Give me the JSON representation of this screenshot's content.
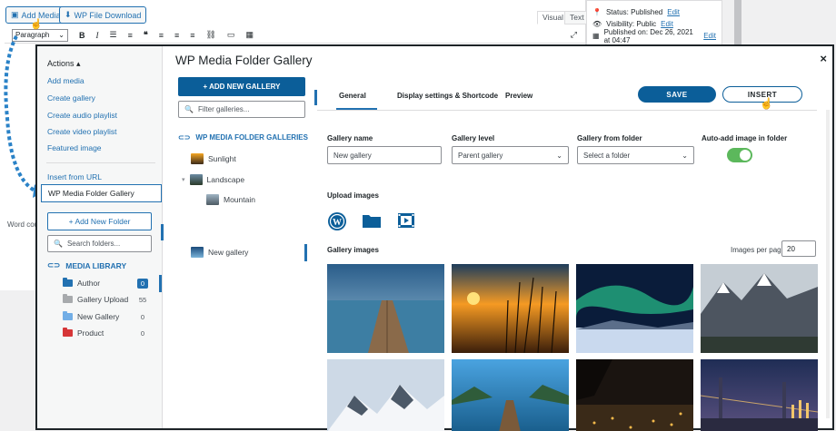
{
  "editor": {
    "add_media_label": "Add Media",
    "wp_file_download_label": "WP File Download",
    "visual_tab": "Visual",
    "text_tab": "Text",
    "paragraph_select": "Paragraph",
    "word_count": "Word cou",
    "publish": {
      "status_label": "Status: Published",
      "status_edit": "Edit",
      "visibility_label": "Visibility: Public",
      "visibility_edit": "Edit",
      "published_on": "Published on: Dec 26, 2021 at 04:47",
      "published_edit": "Edit"
    },
    "toolbar_icons": [
      "bold-icon",
      "italic-icon",
      "bulleted-list-icon",
      "numbered-list-icon",
      "blockquote-icon",
      "align-left-icon",
      "align-center-icon",
      "align-right-icon",
      "link-icon",
      "read-more-icon",
      "toolbar-toggle-icon",
      "fullscreen-icon"
    ]
  },
  "modal": {
    "title": "WP Media Folder Gallery",
    "close": "×",
    "menu": {
      "actions": "Actions",
      "items": [
        "Add media",
        "Create gallery",
        "Create audio playlist",
        "Create video playlist",
        "Featured image"
      ],
      "insert_from_url": "Insert from URL",
      "active": "WP Media Folder Gallery"
    },
    "folders": {
      "add_button": "+ Add New Folder",
      "search_placeholder": "Search folders...",
      "library_title": "MEDIA LIBRARY",
      "items": [
        {
          "name": "Author",
          "count": "0",
          "color": "#2271b1"
        },
        {
          "name": "Gallery Upload",
          "count": "55",
          "color": "#a7aaad"
        },
        {
          "name": "New Gallery",
          "count": "0",
          "color": "#72aee6"
        },
        {
          "name": "Product",
          "count": "0",
          "color": "#d63638"
        }
      ]
    },
    "galleries": {
      "add_button": "+ ADD NEW GALLERY",
      "filter_placeholder": "Filter galleries...",
      "header": "WP MEDIA FOLDER GALLERIES",
      "items": [
        {
          "name": "Sunlight"
        },
        {
          "name": "Landscape"
        },
        {
          "name": "Mountain"
        },
        {
          "name": "New gallery"
        }
      ]
    },
    "tabs": [
      "General",
      "Display settings & Shortcode",
      "Preview"
    ],
    "save_label": "SAVE",
    "insert_label": "INSERT",
    "fields": {
      "gallery_name_label": "Gallery name",
      "gallery_name_value": "New gallery",
      "gallery_level_label": "Gallery level",
      "gallery_level_value": "Parent gallery",
      "gallery_folder_label": "Gallery from folder",
      "gallery_folder_value": "Select a folder",
      "auto_add_label": "Auto-add image in folder",
      "auto_add_on": true
    },
    "upload_images_label": "Upload images",
    "upload_icons": [
      "wordpress-icon",
      "folder-icon",
      "video-icon"
    ],
    "gallery_images_label": "Gallery images",
    "images_per_page_label": "Images per page",
    "images_per_page_value": "20",
    "images": [
      "pier-sunset-image",
      "sunset-reeds-image",
      "aurora-image",
      "mountain-peaks-image",
      "snowy-mountains-image",
      "lake-pier-image",
      "city-night-image",
      "bridge-night-image"
    ]
  },
  "colors": {
    "accent": "#2271b1",
    "primary_button": "#0b5e99",
    "toggle_on": "#5cb85c"
  }
}
